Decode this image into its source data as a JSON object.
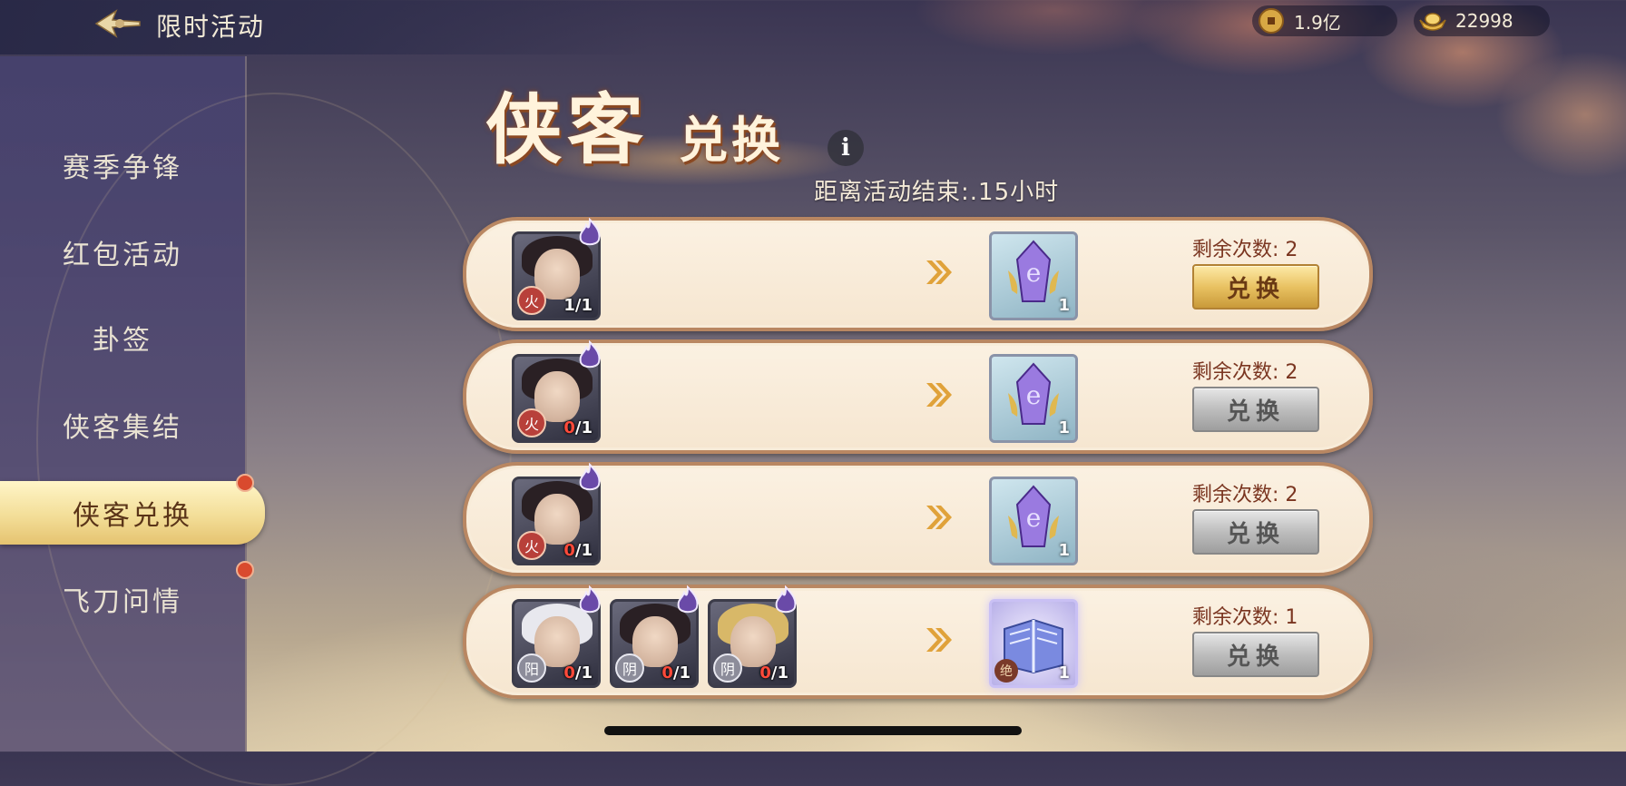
{
  "header": {
    "title": "限时活动",
    "currencies": [
      {
        "icon": "copper-coin-icon",
        "amount": "1.9亿"
      },
      {
        "icon": "gold-ingot-icon",
        "amount": "22998"
      }
    ]
  },
  "sidebar": {
    "items": [
      {
        "label": "赛季争锋",
        "active": false,
        "dot": false
      },
      {
        "label": "红包活动",
        "active": false,
        "dot": false
      },
      {
        "label": "卦签",
        "active": false,
        "dot": false
      },
      {
        "label": "侠客集结",
        "active": false,
        "dot": false
      },
      {
        "label": "侠客兑换",
        "active": true,
        "dot": true
      },
      {
        "label": "飞刀问情",
        "active": false,
        "dot": true
      }
    ]
  },
  "activity": {
    "title_big": "侠客",
    "title_small": "兑换",
    "info_label": "i",
    "countdown": "距离活动结束:.15小时"
  },
  "exchanges": [
    {
      "heroes": [
        {
          "element": "火",
          "owned": "1",
          "required": "1",
          "hair": "dark"
        }
      ],
      "reward": {
        "type": "crystal",
        "quantity": "1"
      },
      "remaining": "剩余次数: 2",
      "button": "兑换",
      "button_state": "enabled"
    },
    {
      "heroes": [
        {
          "element": "火",
          "owned": "0",
          "required": "1",
          "hair": "dark"
        }
      ],
      "reward": {
        "type": "crystal",
        "quantity": "1"
      },
      "remaining": "剩余次数: 2",
      "button": "兑换",
      "button_state": "disabled"
    },
    {
      "heroes": [
        {
          "element": "火",
          "owned": "0",
          "required": "1",
          "hair": "dark"
        }
      ],
      "reward": {
        "type": "crystal",
        "quantity": "1"
      },
      "remaining": "剩余次数: 2",
      "button": "兑换",
      "button_state": "disabled"
    },
    {
      "heroes": [
        {
          "element": "阳",
          "owned": "0",
          "required": "1",
          "hair": "light"
        },
        {
          "element": "阴",
          "owned": "0",
          "required": "1",
          "hair": "dark"
        },
        {
          "element": "阴",
          "owned": "0",
          "required": "1",
          "hair": "gold"
        }
      ],
      "reward": {
        "type": "book",
        "quantity": "1",
        "badge": "绝"
      },
      "remaining": "剩余次数: 1",
      "button": "兑换",
      "button_state": "disabled"
    }
  ],
  "colors": {
    "accent_gold": "#e9c262",
    "row_border": "#b98762",
    "text_red": "#7a3520",
    "zero_count": "#ff4a3a"
  }
}
